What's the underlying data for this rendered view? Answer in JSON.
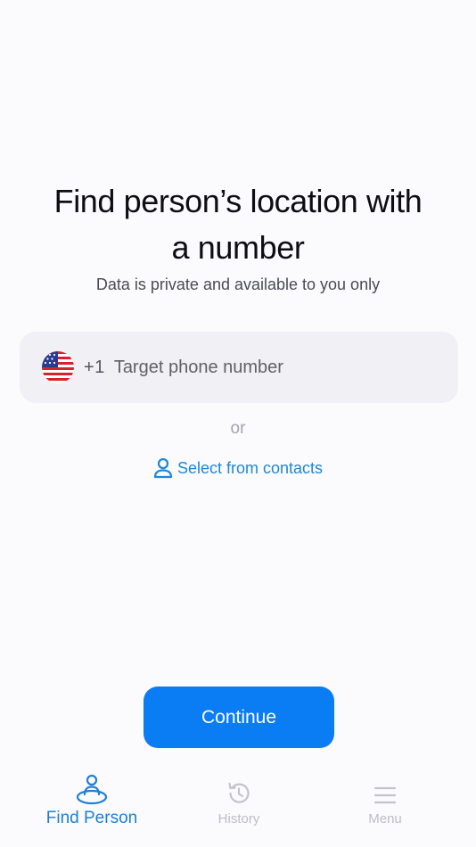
{
  "colors": {
    "accent": "#0a7cf4",
    "link": "#1a88db",
    "tab_active": "#1d7fd6",
    "tab_inactive": "#bdbdc4",
    "field_bg": "#f1f0f4"
  },
  "main": {
    "headline_line1": "Find person’s location with",
    "headline_line2": "a number",
    "subtitle": "Data is private and available to you only"
  },
  "phone": {
    "flag_icon": "us-flag-icon",
    "country_code": "+1",
    "placeholder": "Target phone number",
    "value": ""
  },
  "separator": {
    "or_text": "or"
  },
  "contacts": {
    "icon": "person-icon",
    "label": "Select from contacts"
  },
  "actions": {
    "continue_label": "Continue"
  },
  "tabs": [
    {
      "label": "Find Person",
      "icon": "person-location-icon",
      "active": true
    },
    {
      "label": "History",
      "icon": "history-icon",
      "active": false
    },
    {
      "label": "Menu",
      "icon": "menu-icon",
      "active": false
    }
  ]
}
